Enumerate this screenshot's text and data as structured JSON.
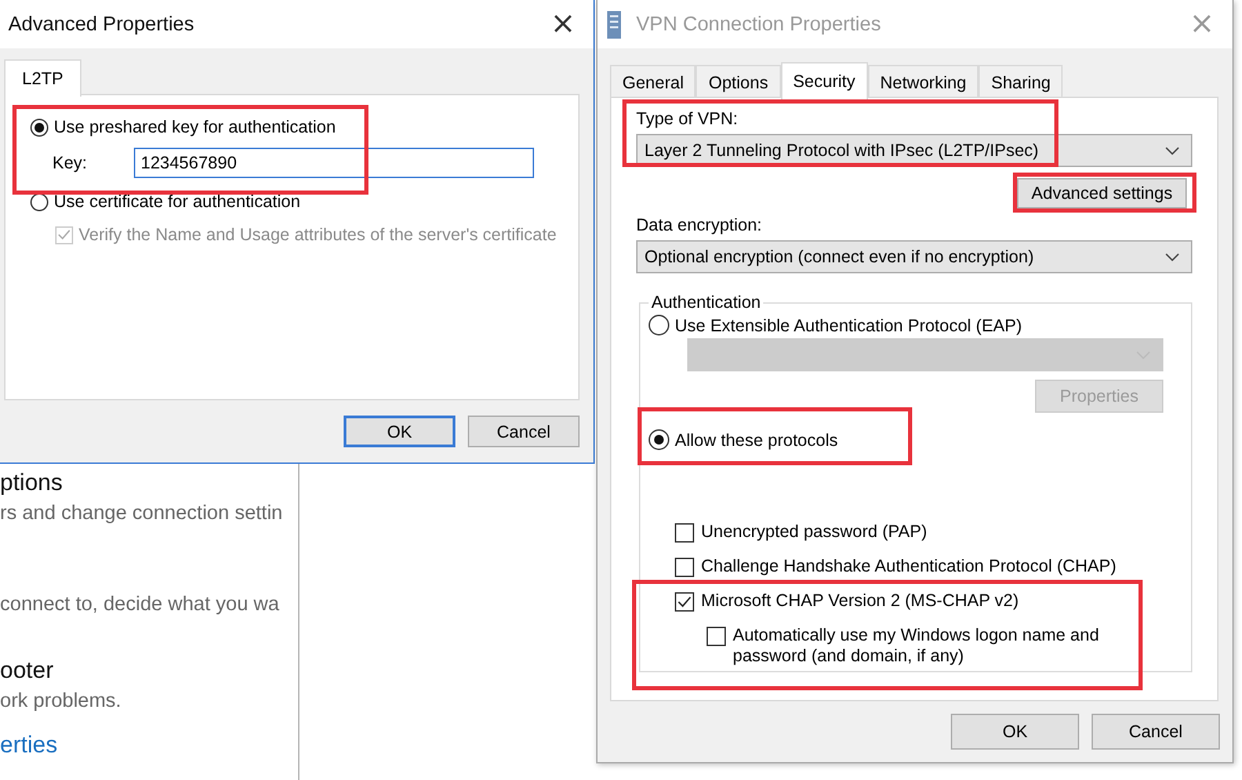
{
  "background_window": {
    "sections": [
      {
        "heading": "ptions",
        "text": "rs and change connection settin"
      },
      {
        "text": "connect to, decide what you wa"
      },
      {
        "heading": "ooter",
        "text": "ork problems."
      }
    ],
    "link": "erties"
  },
  "advanced_dialog": {
    "title": "Advanced Properties",
    "close": "×",
    "tabs": [
      {
        "label": "L2TP",
        "selected": true
      }
    ],
    "preshared": {
      "label": "Use preshared key for authentication",
      "selected": true,
      "highlighted": true
    },
    "key": {
      "label": "Key:",
      "value": "1234567890"
    },
    "certificate": {
      "label": "Use certificate for authentication",
      "selected": false
    },
    "verify": {
      "label": "Verify the Name and Usage attributes of the server's certificate",
      "checked": true,
      "disabled": true
    },
    "buttons": [
      {
        "label": "OK",
        "default": true
      },
      {
        "label": "Cancel",
        "default": false
      }
    ]
  },
  "vpn_dialog": {
    "title": "VPN Connection Properties",
    "close": "×",
    "tabs": [
      {
        "label": "General",
        "selected": false
      },
      {
        "label": "Options",
        "selected": false
      },
      {
        "label": "Security",
        "selected": true
      },
      {
        "label": "Networking",
        "selected": false
      },
      {
        "label": "Sharing",
        "selected": false
      }
    ],
    "vpn_type": {
      "label": "Type of VPN:",
      "value": "Layer 2 Tunneling Protocol with IPsec (L2TP/IPsec)",
      "highlighted": true
    },
    "advanced_button": {
      "label": "Advanced settings",
      "highlighted": true
    },
    "encryption": {
      "label": "Data encryption:",
      "value": "Optional encryption (connect even if no encryption)"
    },
    "authentication": {
      "title": "Authentication",
      "eap": {
        "label": "Use Extensible Authentication Protocol (EAP)",
        "selected": false
      },
      "properties_button": {
        "label": "Properties",
        "disabled": true
      },
      "allow": {
        "label": "Allow these protocols",
        "selected": true,
        "highlighted": true
      },
      "protocols": [
        {
          "label": "Unencrypted password (PAP)",
          "checked": false,
          "highlighted": false
        },
        {
          "label": "Challenge Handshake Authentication Protocol (CHAP)",
          "checked": false,
          "highlighted": false
        },
        {
          "label": "Microsoft CHAP Version 2 (MS-CHAP v2)",
          "checked": true,
          "highlighted": true,
          "children": [
            {
              "label": "Automatically use my Windows logon name and password (and domain, if any)",
              "checked": false
            }
          ]
        }
      ]
    },
    "buttons": [
      {
        "label": "OK",
        "default": false
      },
      {
        "label": "Cancel",
        "default": false
      }
    ]
  }
}
